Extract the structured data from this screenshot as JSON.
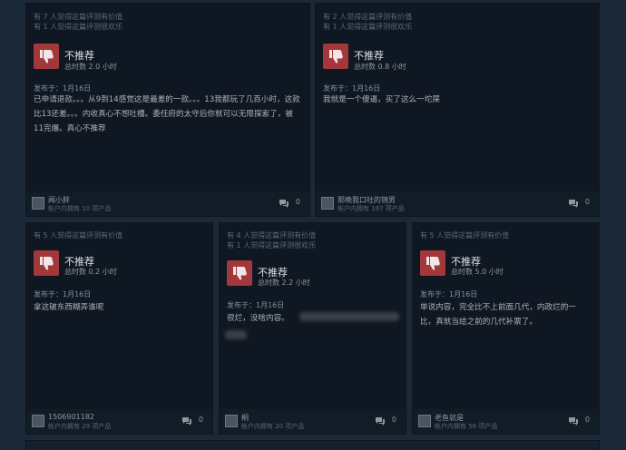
{
  "reviews": [
    {
      "helpful": "有 7 人觉得这篇评测有价值",
      "funny": "有 1 人觉得这篇评测很欢乐",
      "verdict": "不推荐",
      "hours": "总时数 2.0 小时",
      "posted": "发布于：1月16日",
      "text": "已申请退款。。。从9到14感觉这是最差的一款。。。13我都玩了几百小时，这款比13还差。。。内收真心不想吐槽。委任府的太守后你就可以无限探索了，被11完爆。真心不推荐",
      "user": "闻小胖",
      "games": "帐户内拥有 10 项产品",
      "comments": "0"
    },
    {
      "helpful": "有 2 人觉得这篇评测有价值",
      "funny": "有 1 人觉得这篇评测很欢乐",
      "verdict": "不推荐",
      "hours": "总时数 0.8 小时",
      "posted": "发布于：1月16日",
      "text": "我就是一个傻逼，买了这么一坨屎",
      "user": "那晚我口吐的锦男",
      "games": "帐户内拥有 187 项产品",
      "comments": "0"
    },
    {
      "helpful": "有 5 人觉得这篇评测有价值",
      "funny": "",
      "verdict": "不推荐",
      "hours": "总时数 0.2 小时",
      "posted": "发布于：1月16日",
      "text": "拿这破东西糊弄谁呢",
      "user": "1506901182",
      "games": "帐户内拥有 29 项产品",
      "comments": "0"
    },
    {
      "helpful": "有 4 人觉得这篇评测有价值",
      "funny": "有 1 人觉得这篇评测很欢乐",
      "verdict": "不推荐",
      "hours": "总时数 2.2 小时",
      "posted": "发布于：1月16日",
      "text": "很烂，没啥内容。",
      "user": "桐",
      "games": "帐户内拥有 20 项产品",
      "comments": "0"
    },
    {
      "helpful": "有 5 人觉得这篇评测有价值",
      "funny": "",
      "verdict": "不推荐",
      "hours": "总时数 5.0 小时",
      "posted": "发布于：1月16日",
      "text": "单说内容，完全比不上前面几代，内政烂的一比，真就当给之前的几代补票了。",
      "user": "老鱼就是",
      "games": "帐户内拥有 58 项产品",
      "comments": "0"
    }
  ],
  "icons": {
    "verdict": "thumbs-down-icon",
    "comment": "comment-icon"
  },
  "colors": {
    "background": "#1b2838",
    "card": "#0f1722",
    "thumb": "#a3383c"
  }
}
